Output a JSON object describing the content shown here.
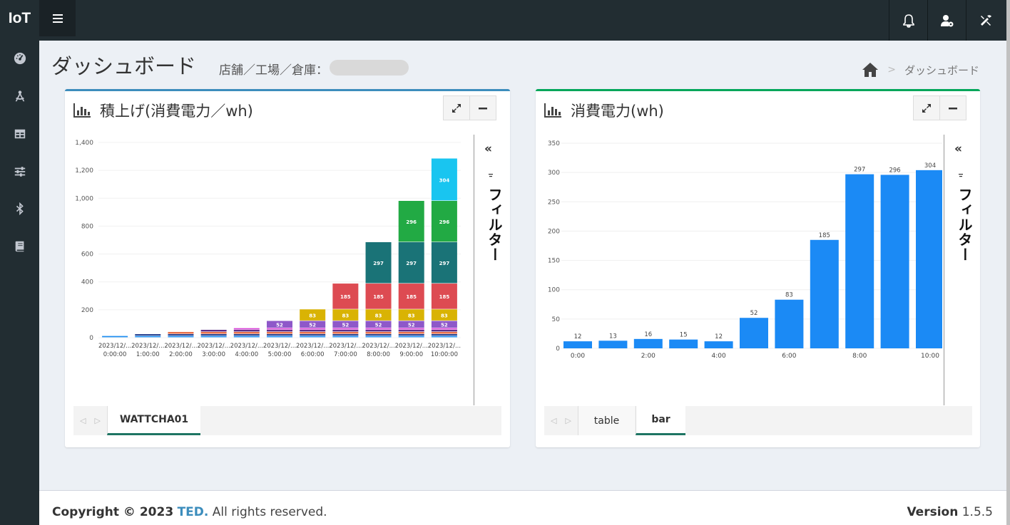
{
  "app": {
    "brand": "IoT"
  },
  "sidebar": {
    "items": [
      {
        "icon": "dashboard-gauge-icon"
      },
      {
        "icon": "drafting-compass-icon"
      },
      {
        "icon": "table-icon"
      },
      {
        "icon": "sliders-icon"
      },
      {
        "icon": "bluetooth-icon"
      },
      {
        "icon": "book-icon"
      }
    ]
  },
  "topbar": {
    "icons": [
      "menu-icon",
      "bell-icon",
      "user-gear-icon",
      "tools-icon"
    ]
  },
  "page": {
    "title": "ダッシュボード",
    "store_label": "店舗／工場／倉庫：",
    "breadcrumb_home": "home-icon",
    "breadcrumb_sep": ">",
    "breadcrumb_current": "ダッシュボード"
  },
  "card1": {
    "title": "積上げ(消費電力／wh)",
    "filter_label": "フィルター",
    "tabs": [
      "WATTCHA01"
    ]
  },
  "card2": {
    "title": "消費電力(wh)",
    "filter_label": "フィルター",
    "tabs": [
      "table",
      "bar"
    ],
    "active_tab": "bar"
  },
  "chart_data": [
    {
      "type": "bar",
      "stacked": true,
      "categories": [
        "2023/12/... 0:00:00",
        "2023/12/... 1:00:00",
        "2023/12/... 2:00:00",
        "2023/12/... 3:00:00",
        "2023/12/... 4:00:00",
        "2023/12/... 5:00:00",
        "2023/12/... 6:00:00",
        "2023/12/... 7:00:00",
        "2023/12/... 8:00:00",
        "2023/12/... 9:00:00",
        "2023/12/... 10:00:00"
      ],
      "series": [
        {
          "color": "#1f8ef1",
          "values": [
            12,
            12,
            12,
            12,
            12,
            12,
            12,
            12,
            12,
            12,
            12
          ]
        },
        {
          "color": "#1e3a8a",
          "values": [
            0,
            13,
            13,
            13,
            13,
            13,
            13,
            13,
            13,
            13,
            13
          ]
        },
        {
          "color": "#e8704a",
          "values": [
            0,
            0,
            16,
            16,
            16,
            16,
            16,
            16,
            16,
            16,
            16
          ]
        },
        {
          "color": "#5b2a86",
          "values": [
            0,
            0,
            0,
            15,
            15,
            15,
            15,
            15,
            15,
            15,
            15
          ]
        },
        {
          "color": "#d63fd6",
          "values": [
            0,
            0,
            0,
            0,
            12,
            12,
            12,
            12,
            12,
            12,
            12
          ]
        },
        {
          "color": "#8e58c9",
          "values": [
            0,
            0,
            0,
            0,
            0,
            52,
            52,
            52,
            52,
            52,
            52
          ]
        },
        {
          "color": "#d9b304",
          "values": [
            0,
            0,
            0,
            0,
            0,
            0,
            83,
            83,
            83,
            83,
            83
          ]
        },
        {
          "color": "#dd4b52",
          "values": [
            0,
            0,
            0,
            0,
            0,
            0,
            0,
            185,
            185,
            185,
            185
          ]
        },
        {
          "color": "#1a7377",
          "values": [
            0,
            0,
            0,
            0,
            0,
            0,
            0,
            0,
            297,
            297,
            297
          ]
        },
        {
          "color": "#22aa44",
          "values": [
            0,
            0,
            0,
            0,
            0,
            0,
            0,
            0,
            0,
            296,
            296
          ]
        },
        {
          "color": "#19c5f0",
          "values": [
            0,
            0,
            0,
            0,
            0,
            0,
            0,
            0,
            0,
            0,
            304
          ]
        }
      ],
      "label_min": 50,
      "ylim": [
        0,
        1400
      ],
      "yticks": [
        "0",
        "200",
        "400",
        "600",
        "800",
        "1,000",
        "1,200",
        "1,400"
      ],
      "grid": true
    },
    {
      "type": "bar",
      "categories": [
        "0:00",
        "1:00",
        "2:00",
        "3:00",
        "4:00",
        "5:00",
        "6:00",
        "7:00",
        "8:00",
        "9:00",
        "10:00"
      ],
      "xtick_labels": [
        "0:00",
        "",
        "2:00",
        "",
        "4:00",
        "",
        "6:00",
        "",
        "8:00",
        "",
        "10:00"
      ],
      "values": [
        12,
        13,
        16,
        15,
        12,
        52,
        83,
        185,
        297,
        296,
        304
      ],
      "color": "#1b8af5",
      "ylim": [
        0,
        350
      ],
      "yticks": [
        "0",
        "50",
        "100",
        "150",
        "200",
        "250",
        "300",
        "350"
      ],
      "grid": true
    }
  ],
  "footer": {
    "copyright_prefix": "Copyright © 2023",
    "company": "TED.",
    "rights": "All rights reserved.",
    "version_label": "Version",
    "version": "1.5.5"
  }
}
